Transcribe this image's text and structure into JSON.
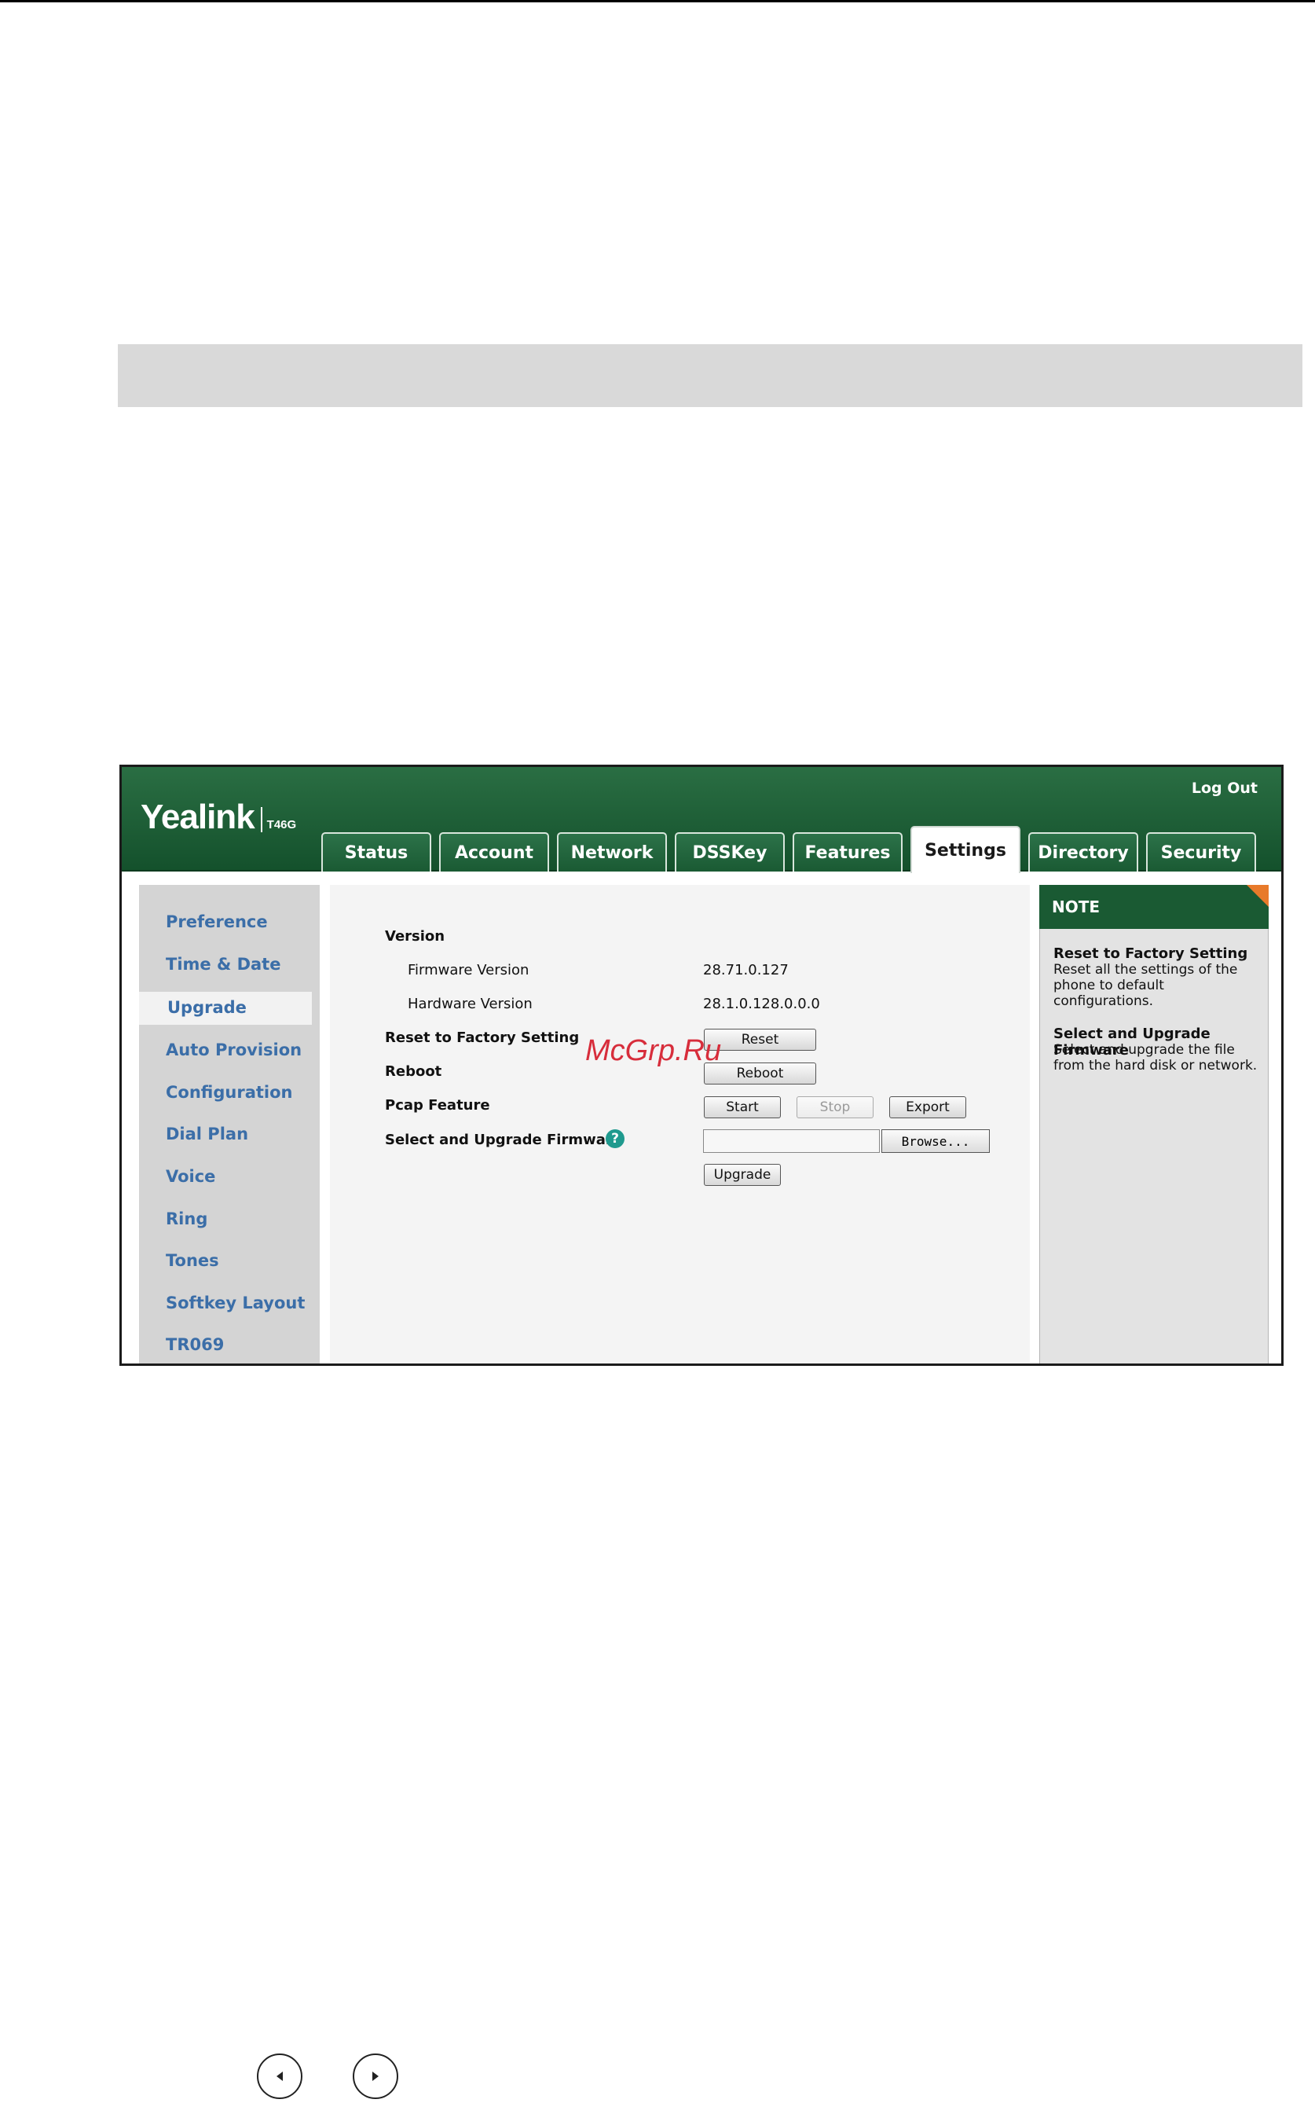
{
  "header": {
    "logo": "Yealink",
    "model": "T46G",
    "logout_label": "Log Out"
  },
  "tabs": [
    {
      "label": "Status"
    },
    {
      "label": "Account"
    },
    {
      "label": "Network"
    },
    {
      "label": "DSSKey"
    },
    {
      "label": "Features"
    },
    {
      "label": "Settings",
      "active": true
    },
    {
      "label": "Directory"
    },
    {
      "label": "Security"
    }
  ],
  "sidebar": {
    "items": [
      {
        "label": "Preference"
      },
      {
        "label": "Time & Date"
      },
      {
        "label": "Upgrade",
        "active": true
      },
      {
        "label": "Auto Provision"
      },
      {
        "label": "Configuration"
      },
      {
        "label": "Dial Plan"
      },
      {
        "label": "Voice"
      },
      {
        "label": "Ring"
      },
      {
        "label": "Tones"
      },
      {
        "label": "Softkey Layout"
      },
      {
        "label": "TR069"
      }
    ]
  },
  "main": {
    "version_heading": "Version",
    "firmware_label": "Firmware Version",
    "firmware_value": "28.71.0.127",
    "hardware_label": "Hardware Version",
    "hardware_value": "28.1.0.128.0.0.0",
    "reset_label": "Reset to Factory Setting",
    "reset_button": "Reset",
    "reboot_label": "Reboot",
    "reboot_button": "Reboot",
    "pcap_label": "Pcap Feature",
    "start_button": "Start",
    "stop_button": "Stop",
    "export_button": "Export",
    "upgrade_label": "Select and Upgrade Firmware",
    "help_glyph": "?",
    "browse_button": "Browse...",
    "upgrade_button": "Upgrade"
  },
  "watermark": "McGrp.Ru",
  "note": {
    "heading": "NOTE",
    "reset_title": "Reset to Factory Setting",
    "reset_text": "Reset all the settings of the phone to default configurations.",
    "upgrade_title": "Select and Upgrade Firmware",
    "upgrade_text": "Select and upgrade the file from the hard disk or network."
  },
  "page_nav": {
    "prev_icon": "chevron-left-icon",
    "next_icon": "chevron-right-icon"
  }
}
